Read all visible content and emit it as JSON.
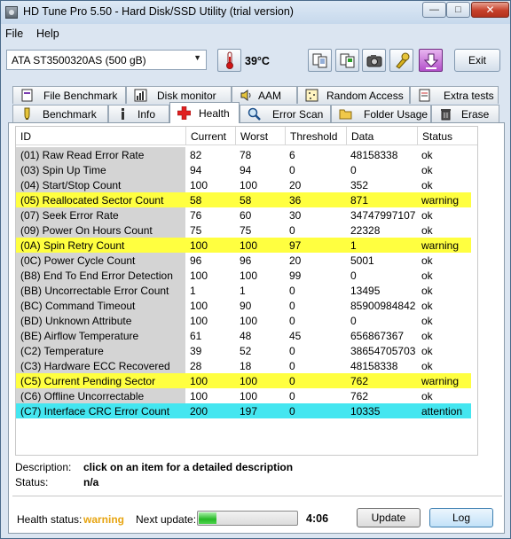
{
  "window": {
    "title": "HD Tune Pro 5.50 - Hard Disk/SSD Utility (trial version)"
  },
  "window_buttons": {
    "minimize": "—",
    "maximize": "□",
    "close": "✕"
  },
  "menu": {
    "file": "File",
    "help": "Help"
  },
  "toolbar": {
    "drive": "ATA    ST3500320AS (500 gB)",
    "temperature": "39°C",
    "exit_label": "Exit",
    "icons": [
      "thermometer-icon",
      "copy-text-icon",
      "copy-screen-icon",
      "camera-icon",
      "options-icon",
      "save-icon"
    ]
  },
  "tabs_row1": [
    {
      "label": "File Benchmark",
      "icon": "file-benchmark-icon"
    },
    {
      "label": "Disk monitor",
      "icon": "disk-monitor-icon"
    },
    {
      "label": "AAM",
      "icon": "speaker-icon"
    },
    {
      "label": "Random Access",
      "icon": "random-access-icon"
    },
    {
      "label": "Extra tests",
      "icon": "extra-tests-icon"
    }
  ],
  "tabs_row2": [
    {
      "label": "Benchmark",
      "icon": "benchmark-icon"
    },
    {
      "label": "Info",
      "icon": "info-icon"
    },
    {
      "label": "Health",
      "icon": "health-cross-icon",
      "active": true
    },
    {
      "label": "Error Scan",
      "icon": "magnifier-icon"
    },
    {
      "label": "Folder Usage",
      "icon": "folder-icon"
    },
    {
      "label": "Erase",
      "icon": "trash-icon"
    }
  ],
  "table": {
    "columns": [
      "ID",
      "Current",
      "Worst",
      "Threshold",
      "Data",
      "Status"
    ],
    "rows": [
      {
        "id": "(01) Raw Read Error Rate",
        "current": "82",
        "worst": "78",
        "threshold": "6",
        "data": "48158338",
        "status": "ok",
        "level": "ok"
      },
      {
        "id": "(03) Spin Up Time",
        "current": "94",
        "worst": "94",
        "threshold": "0",
        "data": "0",
        "status": "ok",
        "level": "ok"
      },
      {
        "id": "(04) Start/Stop Count",
        "current": "100",
        "worst": "100",
        "threshold": "20",
        "data": "352",
        "status": "ok",
        "level": "ok"
      },
      {
        "id": "(05) Reallocated Sector Count",
        "current": "58",
        "worst": "58",
        "threshold": "36",
        "data": "871",
        "status": "warning",
        "level": "warn"
      },
      {
        "id": "(07) Seek Error Rate",
        "current": "76",
        "worst": "60",
        "threshold": "30",
        "data": "34747997107",
        "status": "ok",
        "level": "ok"
      },
      {
        "id": "(09) Power On Hours Count",
        "current": "75",
        "worst": "75",
        "threshold": "0",
        "data": "22328",
        "status": "ok",
        "level": "ok"
      },
      {
        "id": "(0A) Spin Retry Count",
        "current": "100",
        "worst": "100",
        "threshold": "97",
        "data": "1",
        "status": "warning",
        "level": "warn"
      },
      {
        "id": "(0C) Power Cycle Count",
        "current": "96",
        "worst": "96",
        "threshold": "20",
        "data": "5001",
        "status": "ok",
        "level": "ok"
      },
      {
        "id": "(B8) End To End Error Detection",
        "current": "100",
        "worst": "100",
        "threshold": "99",
        "data": "0",
        "status": "ok",
        "level": "ok"
      },
      {
        "id": "(BB) Uncorrectable Error Count",
        "current": "1",
        "worst": "1",
        "threshold": "0",
        "data": "13495",
        "status": "ok",
        "level": "ok"
      },
      {
        "id": "(BC) Command Timeout",
        "current": "100",
        "worst": "90",
        "threshold": "0",
        "data": "85900984842",
        "status": "ok",
        "level": "ok"
      },
      {
        "id": "(BD) Unknown Attribute",
        "current": "100",
        "worst": "100",
        "threshold": "0",
        "data": "0",
        "status": "ok",
        "level": "ok"
      },
      {
        "id": "(BE) Airflow Temperature",
        "current": "61",
        "worst": "48",
        "threshold": "45",
        "data": "656867367",
        "status": "ok",
        "level": "ok"
      },
      {
        "id": "(C2) Temperature",
        "current": "39",
        "worst": "52",
        "threshold": "0",
        "data": "38654705703",
        "status": "ok",
        "level": "ok"
      },
      {
        "id": "(C3) Hardware ECC Recovered",
        "current": "28",
        "worst": "18",
        "threshold": "0",
        "data": "48158338",
        "status": "ok",
        "level": "ok"
      },
      {
        "id": "(C5) Current Pending Sector",
        "current": "100",
        "worst": "100",
        "threshold": "0",
        "data": "762",
        "status": "warning",
        "level": "warn"
      },
      {
        "id": "(C6) Offline Uncorrectable",
        "current": "100",
        "worst": "100",
        "threshold": "0",
        "data": "762",
        "status": "ok",
        "level": "ok"
      },
      {
        "id": "(C7) Interface CRC Error Count",
        "current": "200",
        "worst": "197",
        "threshold": "0",
        "data": "10335",
        "status": "attention",
        "level": "attn"
      }
    ]
  },
  "description": {
    "label": "Description:",
    "value": "click on an item for a detailed description",
    "status_label": "Status:",
    "status_value": "n/a"
  },
  "footer": {
    "health_label": "Health status:",
    "health_value": "warning",
    "next_update_label": "Next update:",
    "progress_fraction": 0.18,
    "countdown": "4:06",
    "update_label": "Update",
    "log_label": "Log"
  },
  "colors": {
    "warning_row": "#ffff40",
    "attention_row": "#44e6f0",
    "health_warning_text": "#e7a410"
  }
}
